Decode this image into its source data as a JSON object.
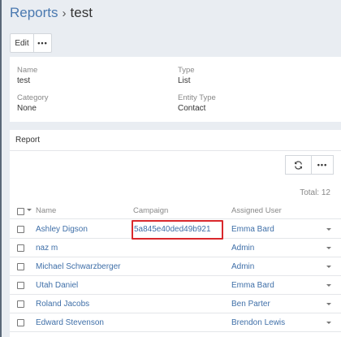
{
  "breadcrumb": {
    "parent": "Reports",
    "separator": "›",
    "current": "test"
  },
  "actions": {
    "edit_label": "Edit",
    "more_label": "•••"
  },
  "details": {
    "name_label": "Name",
    "name_value": "test",
    "type_label": "Type",
    "type_value": "List",
    "category_label": "Category",
    "category_value": "None",
    "entity_type_label": "Entity Type",
    "entity_type_value": "Contact"
  },
  "report": {
    "title": "Report",
    "more_label": "•••",
    "total": "Total: 12",
    "columns": {
      "name": "Name",
      "campaign": "Campaign",
      "assigned_user": "Assigned User"
    },
    "rows": [
      {
        "name": "Ashley Digson",
        "campaign": "5a845e40ded49b921",
        "assigned_user": "Emma Bard"
      },
      {
        "name": "naz m",
        "campaign": "",
        "assigned_user": "Admin"
      },
      {
        "name": "Michael Schwarzberger",
        "campaign": "",
        "assigned_user": "Admin"
      },
      {
        "name": "Utah Daniel",
        "campaign": "",
        "assigned_user": "Emma Bard"
      },
      {
        "name": "Roland Jacobs",
        "campaign": "",
        "assigned_user": "Ben Parter"
      },
      {
        "name": "Edward Stevenson",
        "campaign": "",
        "assigned_user": "Brendon Lewis"
      }
    ]
  },
  "colors": {
    "link": "#3f6fa8",
    "highlight": "#d9282c",
    "background": "#e9edf2"
  },
  "icons": {
    "refresh": "refresh-icon"
  }
}
